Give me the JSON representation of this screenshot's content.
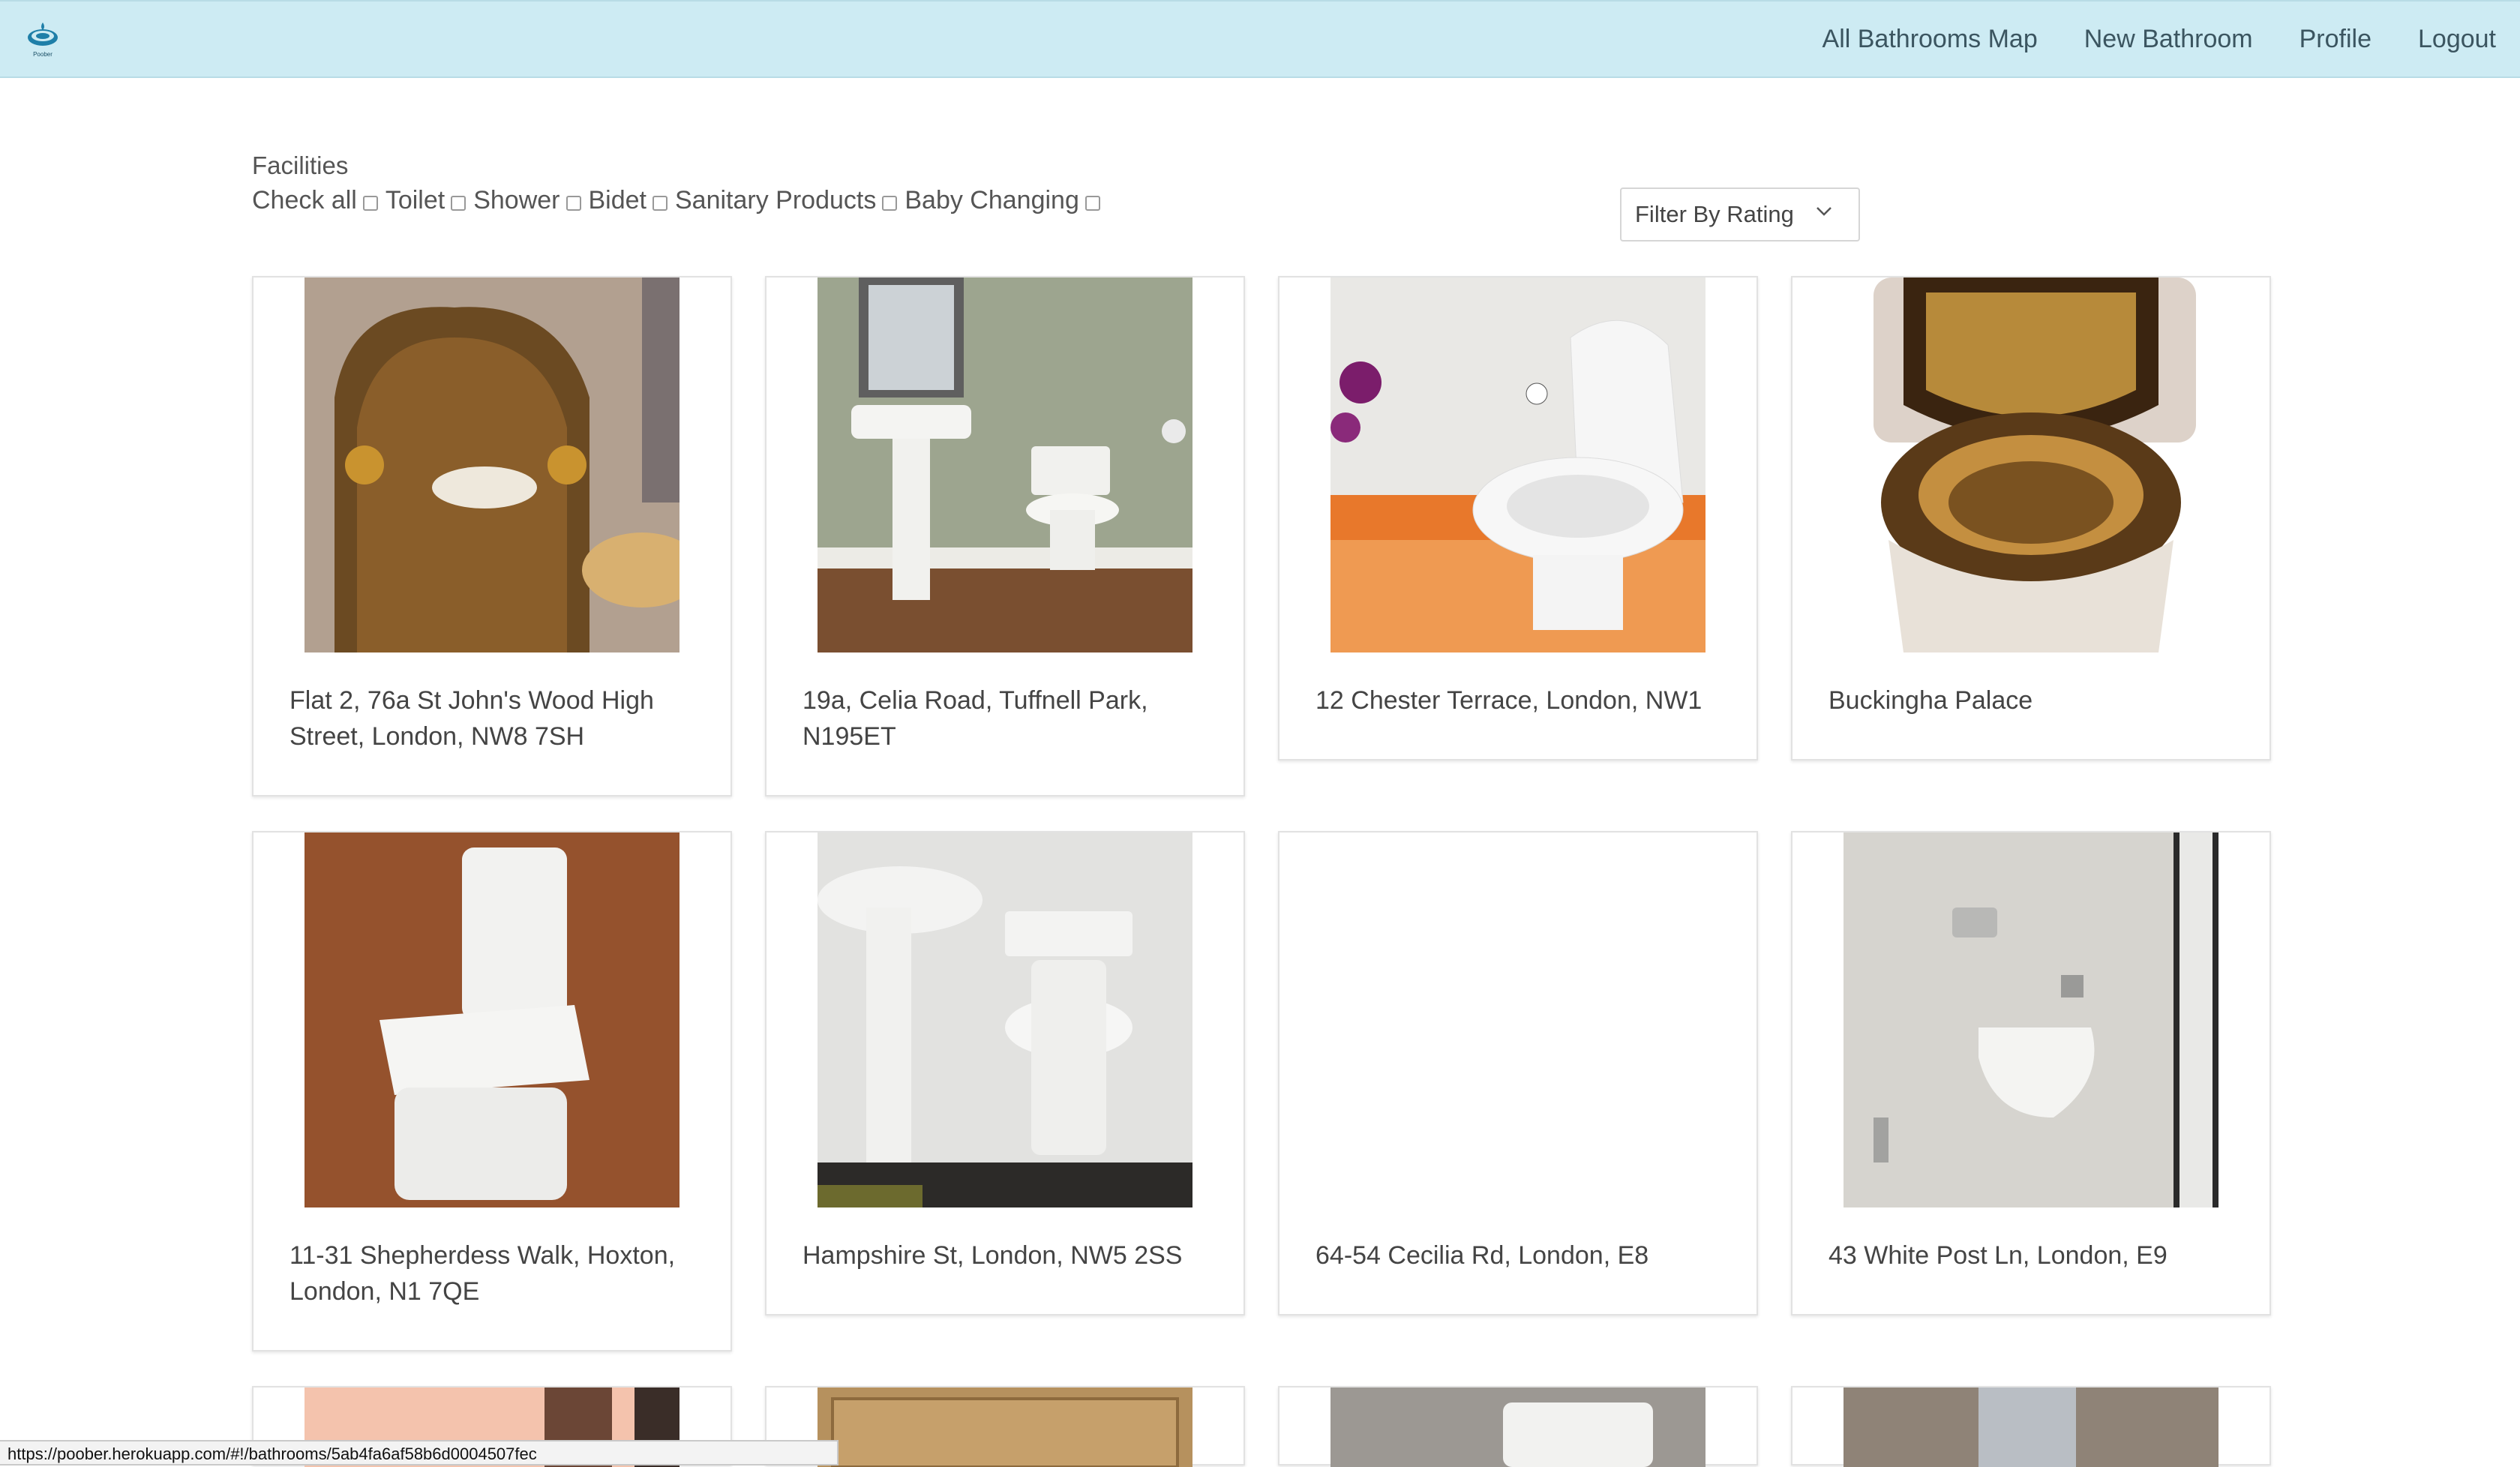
{
  "app": {
    "logo_text": "Poober"
  },
  "nav": {
    "links": [
      "All Bathrooms Map",
      "New Bathroom",
      "Profile",
      "Logout"
    ]
  },
  "facilities": {
    "title": "Facilities",
    "options": [
      "Check all",
      "Toilet",
      "Shower",
      "Bidet",
      "Sanitary Products",
      "Baby Changing"
    ]
  },
  "filter": {
    "label": "Filter By Rating"
  },
  "cards": [
    {
      "address": "Flat 2, 76a St John's Wood High Street, London, NW8 7SH",
      "image": "gold-mosaic-throne-toilet"
    },
    {
      "address": "19a, Celia Road, Tuffnell Park, N195ET",
      "image": "pedestal-sink-and-toilet"
    },
    {
      "address": "12 Chester Terrace, London, NW1",
      "image": "white-toilet-orange-floor"
    },
    {
      "address": "Buckingha Palace",
      "image": "gold-toilet-seat"
    },
    {
      "address": "11-31 Shepherdess Walk, Hoxton, London, N1 7QE",
      "image": "close-coupled-toilet-wood-wall"
    },
    {
      "address": "Hampshire St, London, NW5 2SS",
      "image": "sink-toilet-tiled-wall"
    },
    {
      "address": "64-54 Cecilia Rd, London, E8",
      "image": ""
    },
    {
      "address": "43 White Post Ln, London, E9",
      "image": "wall-hung-toilet"
    }
  ],
  "status_url": "https://poober.herokuapp.com/#!/bathrooms/5ab4fa6af58b6d0004507fec"
}
